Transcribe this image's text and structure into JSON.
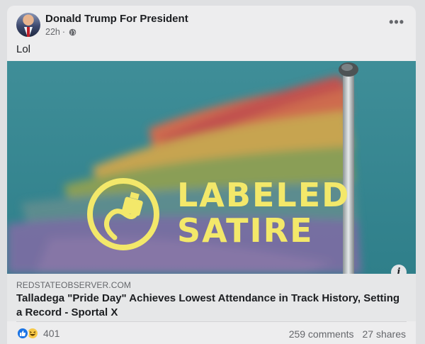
{
  "post": {
    "author": "Donald Trump For President",
    "time": "22h",
    "separator": "·",
    "audience_icon": "globe-icon",
    "more_icon": "•••",
    "caption": "Lol"
  },
  "image": {
    "overlay_line1": "LABELED",
    "overlay_line2": "SATIRE",
    "overlay_color": "#f3e86a",
    "info_icon": "i"
  },
  "link": {
    "domain": "REDSTATEOBSERVER.COM",
    "headline": "Talladega \"Pride Day\" Achieves Lowest Attendance in Track History, Setting a Record - Sportal X"
  },
  "stats": {
    "reaction_icons": [
      "like-icon",
      "haha-icon"
    ],
    "reaction_count": "401",
    "comments": "259 comments",
    "shares": "27 shares"
  }
}
